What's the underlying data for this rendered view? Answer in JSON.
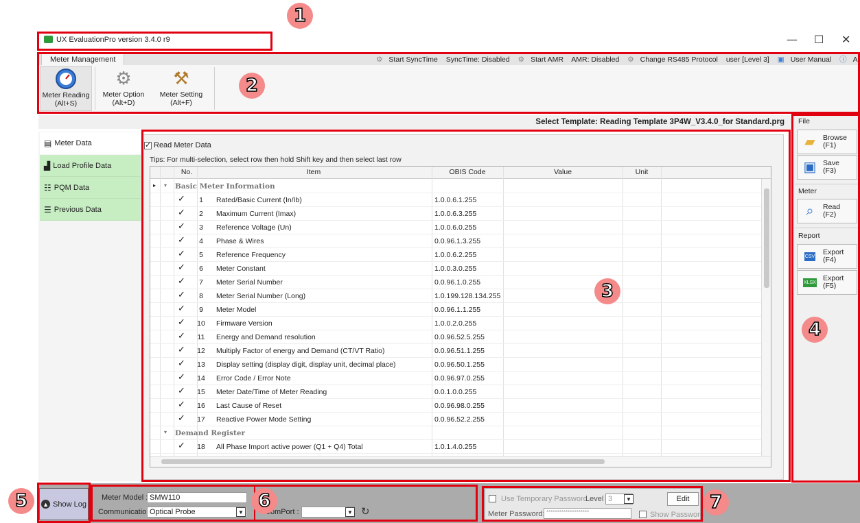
{
  "window": {
    "title": "UX EvaluationPro version 3.4.0 r9",
    "minimize": "—",
    "maximize": "☐",
    "close": "✕"
  },
  "ribbon": {
    "tab": "Meter Management",
    "top_items": [
      "Start SyncTime",
      "SyncTime: Disabled",
      "Start AMR",
      "AMR: Disabled",
      "Change RS485 Protocol",
      "user [Level 3]",
      "User Manual",
      "About"
    ],
    "buttons": [
      {
        "label": "Meter Reading",
        "shortcut": "(Alt+S)",
        "icon": "gauge-icon"
      },
      {
        "label": "Meter Option",
        "shortcut": "(Alt+D)",
        "icon": "gears-icon"
      },
      {
        "label": "Meter Setting",
        "shortcut": "(Alt+F)",
        "icon": "tools-icon"
      }
    ]
  },
  "template_label": "Select Template: Reading Template 3P4W_V3.4.0_for Standard.prg",
  "nav": {
    "items": [
      "Meter Data",
      "Load Profile Data",
      "PQM Data",
      "Previous Data"
    ],
    "active": "Meter Data"
  },
  "main": {
    "read_checkbox": "Read Meter Data",
    "read_checked": true,
    "tips": "Tips: For multi-selection, select row then hold Shift key and then select last row",
    "columns": [
      "No.",
      "Item",
      "OBIS Code",
      "Value",
      "Unit"
    ],
    "groups": [
      {
        "name": "Basic Meter Information",
        "rows": [
          {
            "no": "1",
            "item": "Rated/Basic Current (In/Ib)",
            "obis": "1.0.0.6.1.255"
          },
          {
            "no": "2",
            "item": "Maximum Current (Imax)",
            "obis": "1.0.0.6.3.255"
          },
          {
            "no": "3",
            "item": "Reference Voltage (Un)",
            "obis": "1.0.0.6.0.255"
          },
          {
            "no": "4",
            "item": "Phase & Wires",
            "obis": "0.0.96.1.3.255"
          },
          {
            "no": "5",
            "item": "Reference Frequency",
            "obis": "1.0.0.6.2.255"
          },
          {
            "no": "6",
            "item": "Meter Constant",
            "obis": "1.0.0.3.0.255"
          },
          {
            "no": "7",
            "item": "Meter Serial Number",
            "obis": "0.0.96.1.0.255"
          },
          {
            "no": "8",
            "item": "Meter Serial Number (Long)",
            "obis": "1.0.199.128.134.255"
          },
          {
            "no": "9",
            "item": "Meter Model",
            "obis": "0.0.96.1.1.255"
          },
          {
            "no": "10",
            "item": "Firmware Version",
            "obis": "1.0.0.2.0.255"
          },
          {
            "no": "11",
            "item": "Energy and Demand resolution",
            "obis": "0.0.96.52.5.255"
          },
          {
            "no": "12",
            "item": "Multiply Factor of energy and Demand (CT/VT Ratio)",
            "obis": "0.0.96.51.1.255"
          },
          {
            "no": "13",
            "item": "Display setting (display digit, display unit, decimal place)",
            "obis": "0.0.96.50.1.255"
          },
          {
            "no": "14",
            "item": "Error Code / Error Note",
            "obis": "0.0.96.97.0.255"
          },
          {
            "no": "15",
            "item": "Meter Date/Time of Meter Reading",
            "obis": "0.0.1.0.0.255"
          },
          {
            "no": "16",
            "item": "Last Cause of Reset",
            "obis": "0.0.96.98.0.255"
          },
          {
            "no": "17",
            "item": "Reactive Power Mode Setting",
            "obis": "0.0.96.52.2.255"
          }
        ]
      },
      {
        "name": "Demand Register",
        "rows": [
          {
            "no": "18",
            "item": "All Phase Import active power (Q1 + Q4) Total",
            "obis": "1.0.1.4.0.255"
          }
        ]
      }
    ]
  },
  "right": {
    "file_title": "File",
    "browse": [
      "Browse",
      "(F1)"
    ],
    "save": [
      "Save",
      "(F3)"
    ],
    "meter_title": "Meter",
    "read": [
      "Read",
      "(F2)"
    ],
    "report_title": "Report",
    "export_csv": [
      "Export",
      "(F4)"
    ],
    "export_xlsx": [
      "Export",
      "(F5)"
    ],
    "csv_tag": "CSV",
    "xlsx_tag": "XLSX"
  },
  "bottom": {
    "show_log": "Show Log",
    "meter_model_label": "Meter Model :",
    "meter_model": "SMW110",
    "communication_label": "Communication",
    "communication": "Optical Probe",
    "comport_label": "ComPort :",
    "comport": "",
    "use_temp_pw": "Use Temporary Password",
    "level_label": "Level",
    "level": "3",
    "edit": "Edit",
    "meter_pw_label": "Meter Password:",
    "meter_pw": "********************",
    "show_pw": "Show Password"
  },
  "annotations": [
    "1",
    "2",
    "3",
    "4",
    "5",
    "6",
    "7"
  ]
}
